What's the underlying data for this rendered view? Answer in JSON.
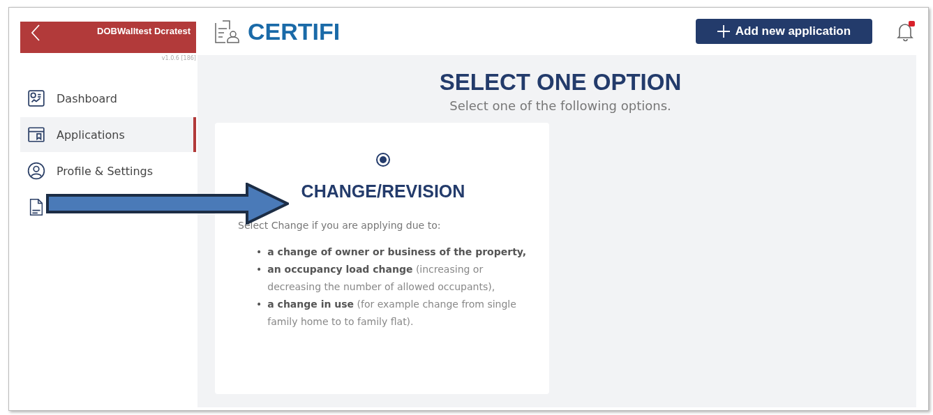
{
  "sidebar": {
    "user_name": "DOBWalltest Dcratest",
    "version": "v1.0.6 [186]",
    "items": [
      {
        "label": "Dashboard",
        "selected": false
      },
      {
        "label": "Applications",
        "selected": true
      },
      {
        "label": "Profile & Settings",
        "selected": false
      },
      {
        "selected": false
      }
    ]
  },
  "header": {
    "logo": "CERTIFI",
    "add_button": "Add new application"
  },
  "main": {
    "title": "SELECT ONE OPTION",
    "subtitle": "Select one of the following options.",
    "options": [
      {
        "title": "CHANGE/REVISION",
        "selected": true,
        "intro": "Select Change if you are applying due to:",
        "bullets": [
          {
            "marker": "•",
            "text": "**a change of owner or business of the property,**"
          },
          {
            "marker": "•",
            "text": "**an occupancy load change** (increasing or decreasing the number of allowed occupants),"
          },
          {
            "marker": "•",
            "text": "**a change in use** (for example change from single family home to to family flat)."
          }
        ]
      }
    ]
  }
}
